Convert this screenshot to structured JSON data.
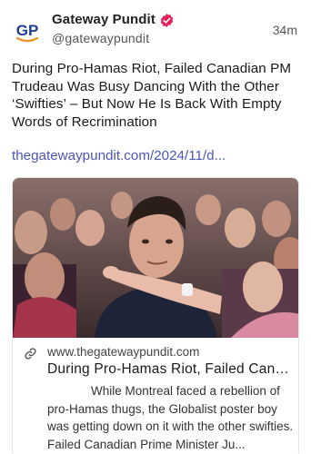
{
  "author": {
    "name": "Gateway Pundit",
    "handle": "@gatewaypundit",
    "avatar_text": "GP",
    "verified": true
  },
  "post": {
    "timestamp": "34m",
    "text": "During Pro-Hamas Riot, Failed Canadian PM Trudeau Was Busy Dancing With the Other ‘Swifties’ – But Now He Is Back With Empty Words of Recrimination",
    "link": "thegatewaypundit.com/2024/11/d..."
  },
  "card": {
    "domain": "www.thegatewaypundit.com",
    "title": "During Pro-Hamas Riot, Failed Canadi...",
    "description": "While Montreal faced a rebellion of pro-Hamas thugs, the Globalist poster boy was getting down on it with the other swifties.   Failed Canadian Prime Minister Ju..."
  },
  "colors": {
    "link": "#4a57b5",
    "verified": "#e0245e",
    "brand_blue": "#1f3f8f",
    "brand_orange": "#f0902a"
  },
  "icons": {
    "verified": "verified-badge-icon",
    "link": "link-icon"
  }
}
